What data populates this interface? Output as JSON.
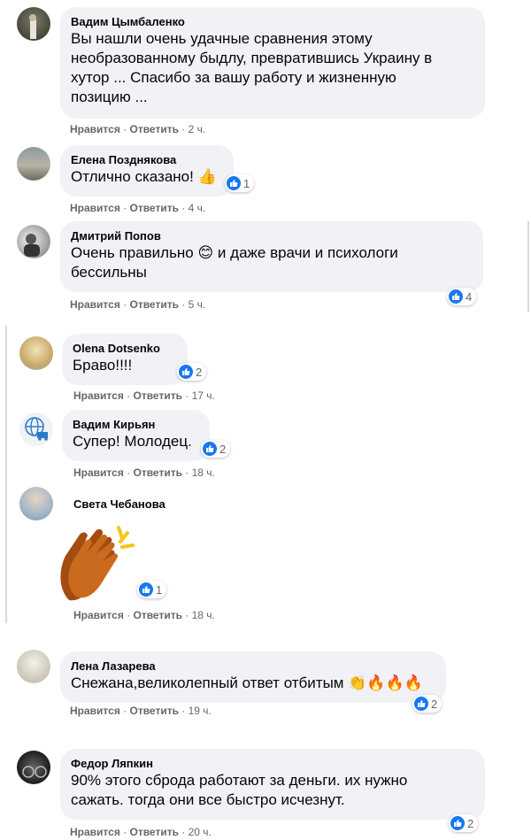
{
  "actions": {
    "like": "Нравится",
    "reply": "Ответить",
    "dot": " · "
  },
  "colors": {
    "bubble": "#f0f2f5",
    "meta": "#65676b",
    "like_blue": "#1877f2"
  },
  "comments": [
    {
      "name": "Вадим Цымбаленко",
      "lines": [
        "Вы нашли очень удачные сравнения этому",
        "необразованному быдлу, превратившись Украину в",
        "хутор ... Спасибо за вашу работу и жизненную",
        "позицию ..."
      ],
      "time": "2 ч."
    },
    {
      "name": "Елена Позднякова",
      "lines": [
        "Отлично сказано! 👍"
      ],
      "time": "4 ч.",
      "reactions": "1"
    },
    {
      "name": "Дмитрий Попов",
      "lines": [
        "Очень правильно 😊 и даже врачи и психологи",
        "бессильны"
      ],
      "time": "5 ч.",
      "reactions": "4"
    },
    {
      "name": "Olena Dotsenko",
      "lines": [
        "Браво!!!!"
      ],
      "time": "17 ч.",
      "reactions": "2"
    },
    {
      "name": "Вадим Кирьян",
      "lines": [
        "Супер! Молодец."
      ],
      "time": "18 ч.",
      "reactions": "2"
    },
    {
      "name": "Света Чебанова",
      "lines": [],
      "time": "18 ч.",
      "reactions": "1",
      "sticker": "clapping-hands-sticker"
    },
    {
      "name": "Лена Лазарева",
      "lines": [
        "Снежана,великолепный ответ отбитым 👏🔥🔥🔥"
      ],
      "time": "19 ч.",
      "reactions": "2"
    },
    {
      "name": "Федор Ляпкин",
      "lines": [
        "90% этого сброда работают за деньги. их нужно",
        "сажать. тогда они все быстро исчезнут."
      ],
      "time": "20 ч.",
      "reactions": "2"
    }
  ]
}
